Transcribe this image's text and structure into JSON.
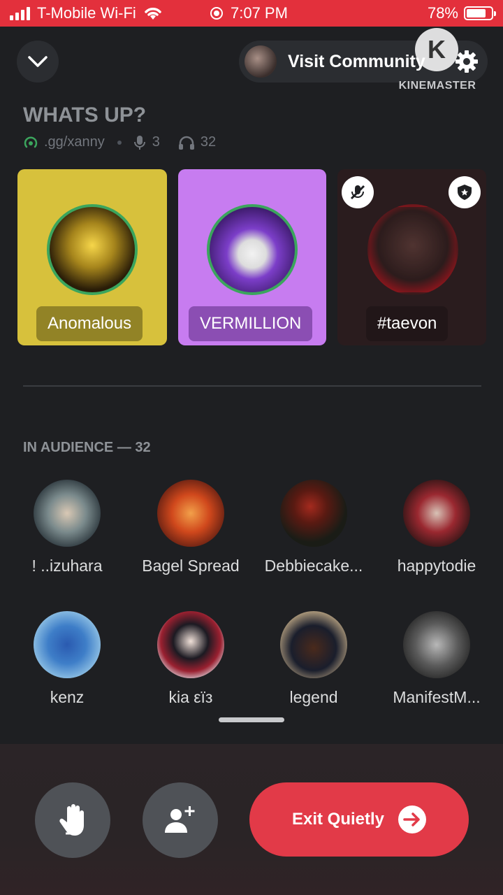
{
  "status_bar": {
    "carrier": "T-Mobile Wi-Fi",
    "time": "7:07 PM",
    "battery": "78%",
    "battery_level": 0.78
  },
  "header": {
    "collapse_icon": "chevron-down-icon",
    "visit_label": "Visit Community",
    "settings_icon": "gear-icon"
  },
  "watermark": {
    "letter": "K",
    "text": "KINEMASTER"
  },
  "stage": {
    "title": "WHATS UP?",
    "invite": ".gg/xanny",
    "speakers_count": "3",
    "listeners_count": "32"
  },
  "speakers": [
    {
      "name": "Anomalous",
      "card_color": "#d7c13c",
      "speaking": true
    },
    {
      "name": "VERMILLION",
      "card_color": "#c77cf0",
      "speaking": true
    },
    {
      "name": "#taevon",
      "card_color": "#2a1c1e",
      "muted": true,
      "moderator": true
    }
  ],
  "audience": {
    "label": "IN AUDIENCE — 32",
    "members": [
      {
        "name": "! ..izuhara"
      },
      {
        "name": "Bagel Spread"
      },
      {
        "name": "Debbiecake..."
      },
      {
        "name": "happytodie"
      },
      {
        "name": "kenz"
      },
      {
        "name": "kia εïз"
      },
      {
        "name": "legend"
      },
      {
        "name": "ManifestM..."
      }
    ]
  },
  "actions": {
    "raise_hand_icon": "raise-hand-icon",
    "invite_icon": "add-user-icon",
    "exit_label": "Exit Quietly",
    "exit_color": "#e23a48"
  }
}
